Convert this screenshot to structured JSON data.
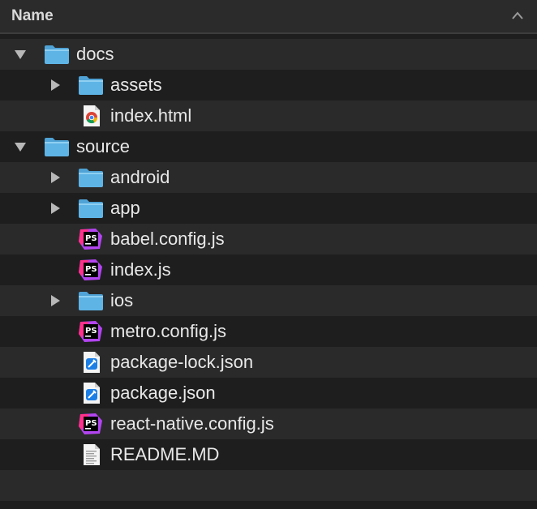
{
  "header": {
    "title": "Name"
  },
  "rows": [
    {
      "name": "docs",
      "kind": "folder",
      "level": 0,
      "expanded": true,
      "icon": "folder-icon"
    },
    {
      "name": "assets",
      "kind": "folder",
      "level": 1,
      "expanded": false,
      "icon": "folder-icon"
    },
    {
      "name": "index.html",
      "kind": "file",
      "level": 1,
      "icon": "chrome-html-file-icon"
    },
    {
      "name": "source",
      "kind": "folder",
      "level": 0,
      "expanded": true,
      "icon": "folder-icon"
    },
    {
      "name": "android",
      "kind": "folder",
      "level": 1,
      "expanded": false,
      "icon": "folder-icon"
    },
    {
      "name": "app",
      "kind": "folder",
      "level": 1,
      "expanded": false,
      "icon": "folder-icon"
    },
    {
      "name": "babel.config.js",
      "kind": "file",
      "level": 1,
      "icon": "phpstorm-file-icon"
    },
    {
      "name": "index.js",
      "kind": "file",
      "level": 1,
      "icon": "phpstorm-file-icon"
    },
    {
      "name": "ios",
      "kind": "folder",
      "level": 1,
      "expanded": false,
      "icon": "folder-icon"
    },
    {
      "name": "metro.config.js",
      "kind": "file",
      "level": 1,
      "icon": "phpstorm-file-icon"
    },
    {
      "name": "package-lock.json",
      "kind": "file",
      "level": 1,
      "icon": "xcode-json-file-icon"
    },
    {
      "name": "package.json",
      "kind": "file",
      "level": 1,
      "icon": "xcode-json-file-icon"
    },
    {
      "name": "react-native.config.js",
      "kind": "file",
      "level": 1,
      "icon": "phpstorm-file-icon"
    },
    {
      "name": "README.MD",
      "kind": "file",
      "level": 1,
      "icon": "text-document-icon"
    }
  ],
  "colors": {
    "background": "#1e1e1e",
    "alt_row": "#2a2a2a",
    "header": "#2b2b2b",
    "folder": "#5fb4e6",
    "phpstorm": "#b345f1"
  }
}
